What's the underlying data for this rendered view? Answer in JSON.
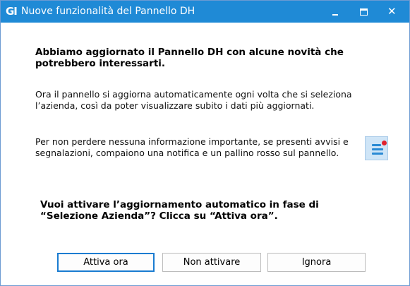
{
  "window": {
    "app_logo": "GI",
    "title": "Nuove funzionalità del Pannello DH",
    "controls": {
      "minimize_icon": "minimize-icon",
      "maximize_icon": "maximize-icon",
      "close_icon": "close-icon"
    }
  },
  "content": {
    "heading": "Abbiamo aggiornato il Pannello DH con alcune novità che potrebbero interessarti.",
    "paragraph1": "Ora il pannello si aggiorna automaticamente ogni volta che si seleziona l’azienda, così da poter visualizzare subito i dati più aggiornati.",
    "paragraph2": "Per non perdere nessuna informazione importante, se presenti avvisi e segnalazioni, compaiono una notifica e un pallino rosso sul pannello.",
    "notification_icon": "menu-notification-icon",
    "question": "Vuoi attivare l’aggiornamento automatico in fase di “Selezione Azienda”? Clicca su “Attiva ora”."
  },
  "buttons": {
    "activate": "Attiva ora",
    "dont_activate": "Non attivare",
    "ignore": "Ignora"
  },
  "colors": {
    "titlebar": "#1f8ad6",
    "accent": "#1a7cd1",
    "notification_dot": "#e0212e"
  }
}
